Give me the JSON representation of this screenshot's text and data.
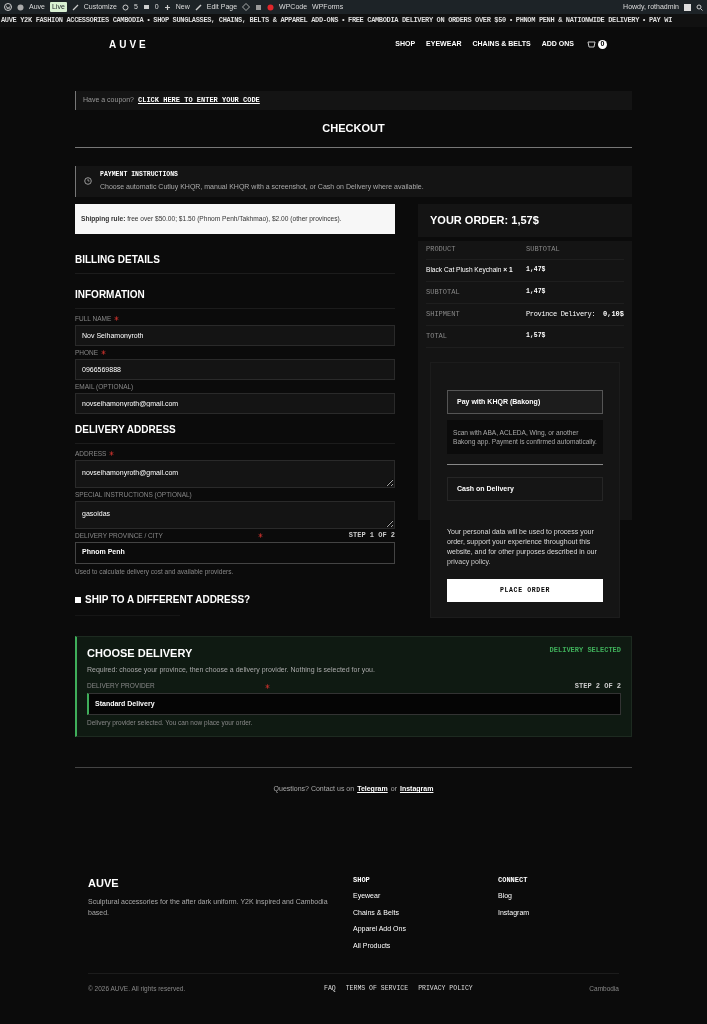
{
  "admin_bar": {
    "site": "Auve",
    "live_badge": "Live",
    "customize": "Customize",
    "updates": "5",
    "comments": "0",
    "new": "New",
    "edit_page": "Edit Page",
    "wpcode": "WPCode",
    "wpforms": "WPForms",
    "greeting": "Howdy, rothadmin"
  },
  "marquee": [
    "AUVE Y2K FASHION ACCESSORIES CAMBODIA",
    "•",
    "SHOP SUNGLASSES, CHAINS, BELTS & APPAREL ADD-ONS",
    "•",
    "FREE CAMBODIA DELIVERY ON ORDERS OVER $50",
    "•",
    "PHNOM PENH & NATIONWIDE DELIVERY",
    "•",
    "PAY WI"
  ],
  "header": {
    "logo": "AUVE",
    "nav": [
      "SHOP",
      "EYEWEAR",
      "CHAINS & BELTS",
      "ADD ONS"
    ],
    "cart_count": "0"
  },
  "coupon": {
    "text": "Have a coupon?",
    "link": "CLICK HERE TO ENTER YOUR CODE"
  },
  "page_title": "CHECKOUT",
  "payment_instructions": {
    "title": "PAYMENT INSTRUCTIONS",
    "text": "Choose automatic Cutluy KHQR, manual KHQR with a screenshot, or Cash on Delivery where available."
  },
  "shipping_rule": "**Shipping rule:** free over $50.00; $1.50 (Phnom Penh/Takhmao), $2.00 (other provinces).",
  "billing": {
    "title": "BILLING DETAILS",
    "sections": [
      {
        "title": "INFORMATION",
        "fields": [
          {
            "kind": "input",
            "label": "FULL NAME",
            "required": true,
            "value": "Nov Seihamonyroth"
          },
          {
            "kind": "input",
            "label": "PHONE",
            "required": true,
            "value": "0966569888"
          },
          {
            "kind": "input",
            "label": "EMAIL (OPTIONAL)",
            "required": false,
            "value": "novseihamonyroth@gmail.com"
          }
        ]
      },
      {
        "title": "DELIVERY ADDRESS",
        "fields": [
          {
            "kind": "textarea",
            "label": "ADDRESS",
            "required": true,
            "value": "novseihamonyroth@gmail.com"
          },
          {
            "kind": "textarea",
            "label": "SPECIAL INSTRUCTIONS (OPTIONAL)",
            "required": false,
            "value": "gasoidas"
          },
          {
            "kind": "select",
            "label": "DELIVERY PROVINCE / CITY",
            "required": true,
            "step": "STEP 1 OF 2",
            "value": "Phnom Penh",
            "help": "Used to calculate delivery cost and available providers."
          }
        ]
      }
    ]
  },
  "ship_different": {
    "label": "SHIP TO A DIFFERENT ADDRESS?",
    "checked": false
  },
  "delivery": {
    "title": "CHOOSE DELIVERY",
    "status": "DELIVERY SELECTED",
    "text": "Required: choose your province, then choose a delivery provider. Nothing is selected for you.",
    "label": "DELIVERY PROVIDER",
    "required": true,
    "step": "STEP 2 OF 2",
    "providers": [
      {
        "name": "Standard Delivery",
        "selected": true
      }
    ],
    "help": "Delivery provider selected. You can now place your order."
  },
  "order": {
    "title": "YOUR ORDER: 1,57$",
    "columns": [
      "PRODUCT",
      "SUBTOTAL"
    ],
    "rows": [
      {
        "kind": "item",
        "label": "Black Cat Plush Keychain",
        "qty": "× 1",
        "value": "1,47$"
      },
      {
        "kind": "summary",
        "label": "SUBTOTAL",
        "value": "1,47$"
      },
      {
        "kind": "shipping",
        "label": "SHIPMENT",
        "method": "Province Delivery:",
        "value": "0,10$"
      },
      {
        "kind": "summary",
        "label": "TOTAL",
        "value": "1,57$"
      }
    ]
  },
  "payment_methods": [
    {
      "label": "Pay with KHQR (Bakong)",
      "selected": true,
      "description": "Scan with ABA, ACLEDA, Wing, or another Bakong app. Payment is confirmed automatically."
    },
    {
      "label": "Cash on Delivery",
      "selected": false
    }
  ],
  "privacy": {
    "text": "Your personal data will be used to process your order, support your experience throughout this website, and for other purposes described in our",
    "link": "privacy policy",
    "end": "."
  },
  "place_order": "PLACE ORDER",
  "contact": {
    "text": "Questions? Contact us on",
    "link1": "Telegram",
    "or": "or",
    "link2": "Instagram"
  },
  "footer": {
    "logo": "AUVE",
    "tagline": "Sculptural accessories for the after dark uniform. Y2K inspired and Cambodia based.",
    "columns": [
      {
        "title": "SHOP",
        "links": [
          "Eyewear",
          "Chains & Belts",
          "Apparel Add Ons",
          "All Products"
        ]
      },
      {
        "title": "CONNECT",
        "links": [
          "Blog",
          "Instagram"
        ]
      }
    ],
    "copyright": "© 2026 AUVE. All rights reserved.",
    "legal": [
      "FAQ",
      "TERMS OF SERVICE",
      "PRIVACY POLICY"
    ],
    "location": "Cambodia"
  }
}
